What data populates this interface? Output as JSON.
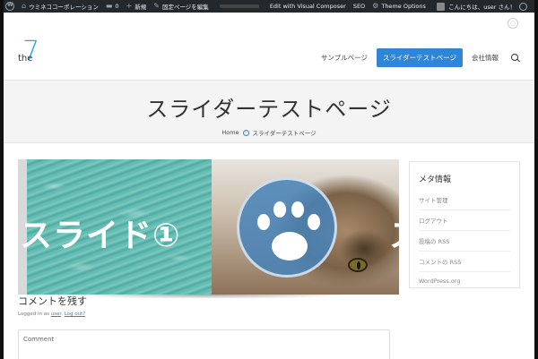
{
  "admin_bar": {
    "site_name": "ウミネココーポレーション",
    "comments_count": "0",
    "new_label": "新規",
    "edit_label": "固定ページを編集",
    "visual_composer": "Edit with Visual Composer",
    "seo": "SEO",
    "theme_options": "Theme Options",
    "greeting": "こんにちは、user さん！"
  },
  "header": {
    "logo_text": "the",
    "nav": [
      "サンプルページ",
      "スライダーテストページ",
      "会社情報"
    ]
  },
  "page": {
    "title": "スライダーテストページ",
    "breadcrumb": {
      "home": "Home",
      "sep": "›",
      "current": "スライダーテストページ"
    }
  },
  "slider": {
    "caption": "スライド①",
    "next_caption_fragment": "ス"
  },
  "comments": {
    "title": "コメントを残す",
    "logged_in_prefix": "Logged in as",
    "user": "user",
    "logout": "Log out?",
    "placeholder": "Comment"
  },
  "sidebar": {
    "widget_title": "メタ情報",
    "items": [
      "サイト管理",
      "ログアウト",
      "投稿の RSS",
      "コメントの RSS",
      "WordPress.org"
    ]
  },
  "colors": {
    "accent": "#2f86d8",
    "admin_bar": "#23282d",
    "logo": "#29a9e0"
  }
}
